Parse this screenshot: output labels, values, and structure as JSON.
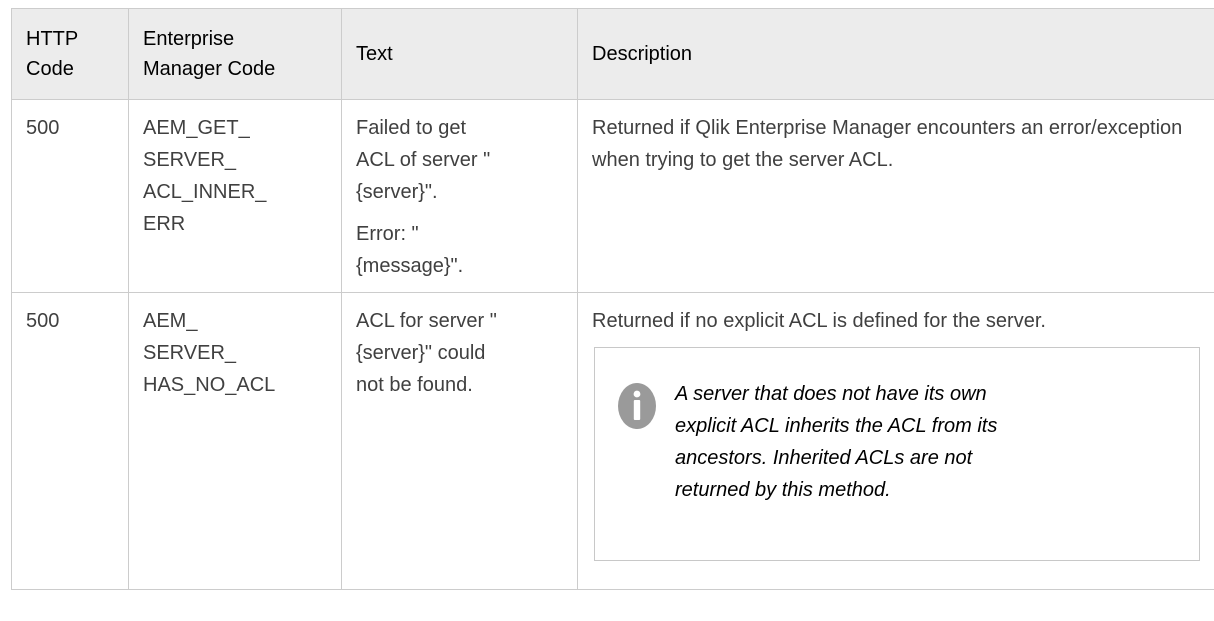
{
  "table": {
    "headers": {
      "http_code": [
        "HTTP",
        "Code"
      ],
      "em_code": [
        "Enterprise",
        "Manager Code"
      ],
      "text": "Text",
      "description": "Description"
    },
    "rows": [
      {
        "http_code": "500",
        "em_code_lines": [
          "AEM_GET_",
          "SERVER_",
          "ACL_INNER_",
          "ERR"
        ],
        "text_para1_lines": [
          "Failed to get",
          "ACL of server \"",
          "{server}\"."
        ],
        "text_para2_lines": [
          "Error: \"",
          "{message}\"."
        ],
        "description": "Returned if Qlik Enterprise Manager encounters an error/exception when trying to get the server ACL."
      },
      {
        "http_code": "500",
        "em_code_lines": [
          "AEM_",
          "SERVER_",
          "HAS_NO_ACL"
        ],
        "text_lines": [
          "ACL for server \"",
          "{server}\" could",
          "not be found."
        ],
        "description": "Returned if no explicit ACL is defined for the server.",
        "note": {
          "icon": "info-icon",
          "lines": [
            "A server that does not have its own",
            "explicit ACL inherits the ACL from its",
            "ancestors. Inherited ACLs are not",
            "returned by this method."
          ]
        }
      }
    ]
  }
}
